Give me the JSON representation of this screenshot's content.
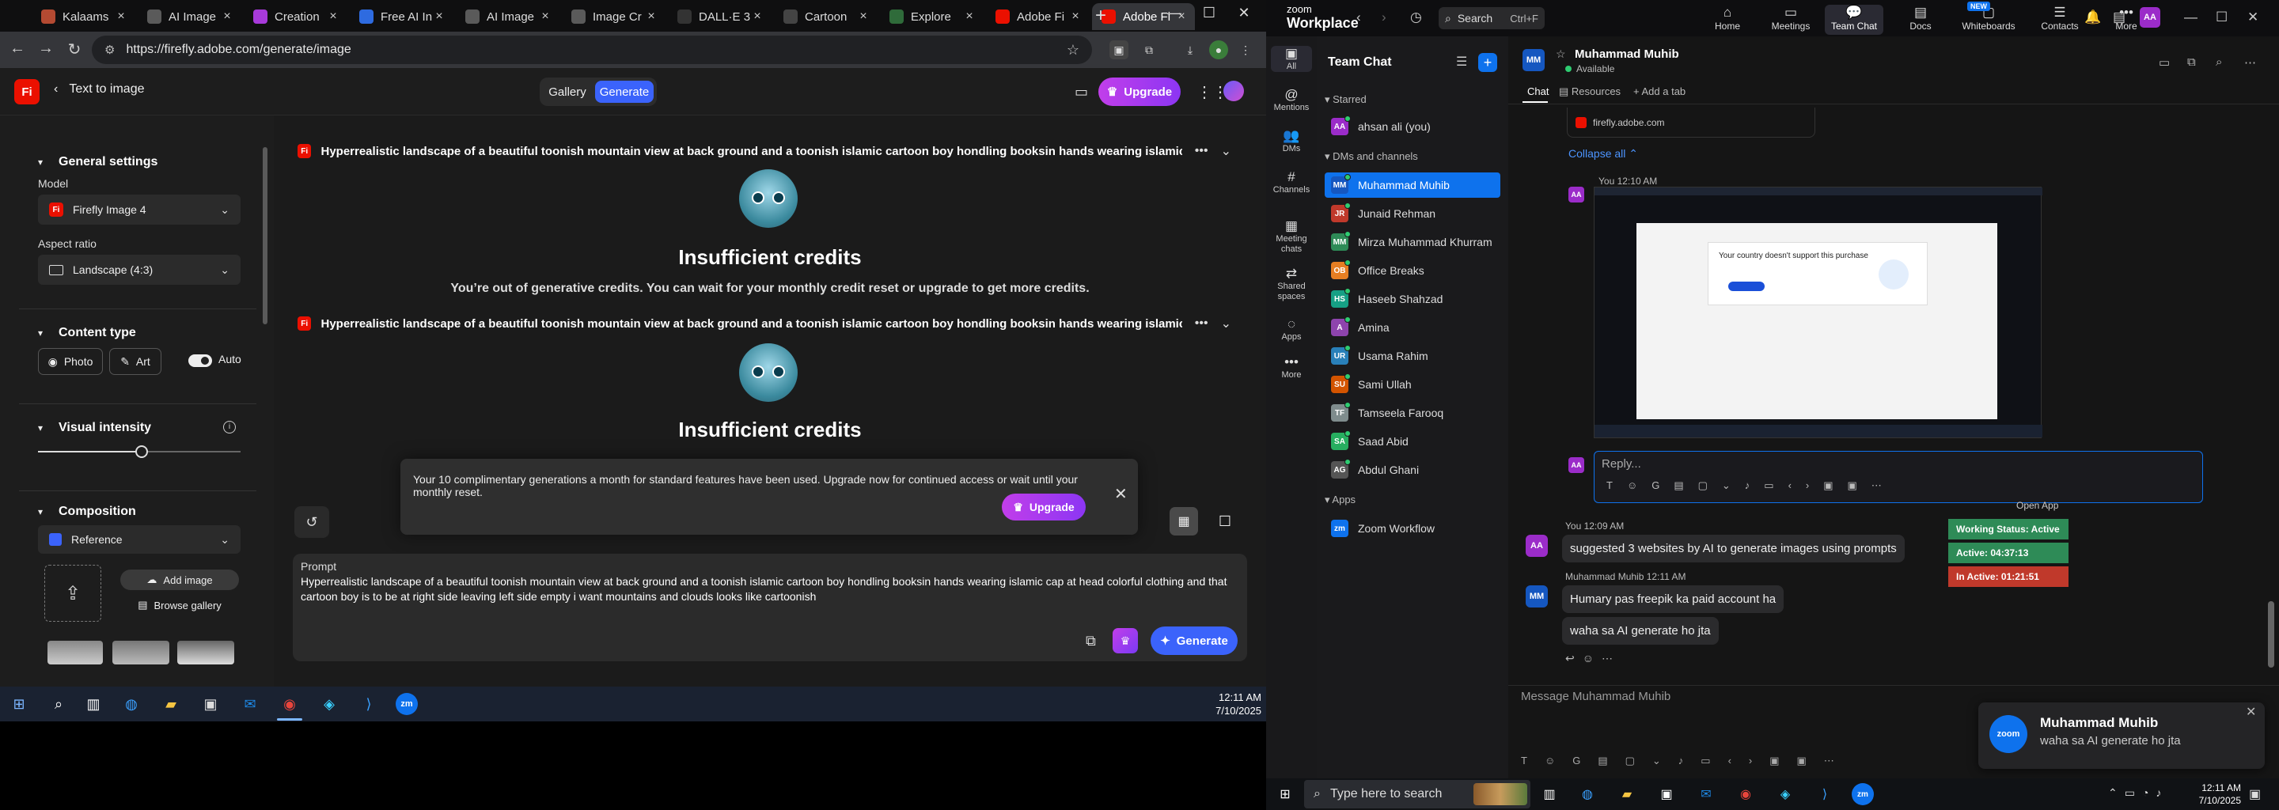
{
  "browser": {
    "tabs": [
      {
        "title": "Kalaams",
        "color": "#b44a32"
      },
      {
        "title": "AI Image",
        "color": "#5a5a5a"
      },
      {
        "title": "Creation",
        "color": "#a83adb"
      },
      {
        "title": "Free AI In",
        "color": "#2e6be0"
      },
      {
        "title": "AI Image",
        "color": "#5a5a5a"
      },
      {
        "title": "Image Cr",
        "color": "#5a5a5a"
      },
      {
        "title": "DALL·E 3",
        "color": "#333"
      },
      {
        "title": "Cartoon",
        "color": "#444"
      },
      {
        "title": "Explore",
        "color": "#2f6b3a"
      },
      {
        "title": "Adobe Fi",
        "color": "#eb1000"
      },
      {
        "title": "Adobe Fi",
        "color": "#eb1000"
      }
    ],
    "url": "https://firefly.adobe.com/generate/image",
    "window_controls": {
      "minimize": "—",
      "maximize": "☐",
      "close": "✕"
    }
  },
  "firefly": {
    "logo": "Fi",
    "back_label": "Text to image",
    "segment": {
      "gallery": "Gallery",
      "generate": "Generate"
    },
    "upgrade": "Upgrade",
    "settings": {
      "general_title": "General settings",
      "model_label": "Model",
      "model_value": "Firefly Image 4",
      "aspect_label": "Aspect ratio",
      "aspect_value": "Landscape (4:3)",
      "content_type_title": "Content type",
      "photo": "Photo",
      "art": "Art",
      "auto": "Auto",
      "visual_intensity_title": "Visual intensity",
      "visual_intensity_value": 0.51,
      "composition_title": "Composition",
      "reference_label": "Reference",
      "add_image": "Add image",
      "browse_gallery": "Browse gallery"
    },
    "generations": [
      {
        "prompt": "Hyperrealistic landscape of a beautiful toonish mountain view at back ground and a toonish islamic cartoon boy hondling booksin hands wearing islamic cap at head cok",
        "title": "Insufficient credits",
        "message": "You’re out of generative credits. You can wait for your monthly credit reset or upgrade to get more credits."
      },
      {
        "prompt": "Hyperrealistic landscape of a beautiful toonish mountain view at back ground and a toonish islamic cartoon boy hondling booksin hands wearing islamic cap at head cok",
        "title": "Insufficient credits",
        "message": ""
      }
    ],
    "toast": {
      "message": "Your 10 complimentary generations a month for standard features have been used. Upgrade now for continued access or wait until your monthly reset.",
      "upgrade": "Upgrade",
      "close": "✕"
    },
    "prompt_box": {
      "label": "Prompt",
      "text": "Hyperrealistic landscape of a beautiful toonish mountain view at back ground and a toonish islamic cartoon boy hondling booksin hands wearing islamic cap at head  colorful clothing and that cartoon boy is to be at right side leaving left side empty i want mountains and clouds looks like cartoonish",
      "generate": "Generate"
    }
  },
  "taskbar_left": {
    "time": "12:11 AM",
    "date": "7/10/2025"
  },
  "zoom": {
    "logo_line1": "zoom",
    "logo_line2": "Workplace",
    "search": "Search",
    "search_shortcut": "Ctrl+F",
    "nav": [
      {
        "label": "Home",
        "glyph": "⌂"
      },
      {
        "label": "Meetings",
        "glyph": "▭"
      },
      {
        "label": "Team Chat",
        "glyph": "💬"
      },
      {
        "label": "Docs",
        "glyph": "▤"
      },
      {
        "label": "Whiteboards",
        "glyph": "▢"
      },
      {
        "label": "Contacts",
        "glyph": "☰"
      },
      {
        "label": "More",
        "glyph": "•••"
      }
    ],
    "new_badge": "NEW",
    "avatar": "AA",
    "rail": [
      {
        "label": "All",
        "glyph": "▣"
      },
      {
        "label": "Mentions",
        "glyph": "@"
      },
      {
        "label": "DMs",
        "glyph": "👥"
      },
      {
        "label": "Channels",
        "glyph": "#"
      },
      {
        "label": "Meeting chats",
        "glyph": "▦"
      },
      {
        "label": "Shared spaces",
        "glyph": "⇄"
      },
      {
        "label": "Apps",
        "glyph": "◌"
      },
      {
        "label": "More",
        "glyph": "•••"
      }
    ],
    "list_title": "Team Chat",
    "starred_header": "Starred",
    "starred": [
      {
        "name": "ahsan ali (you)",
        "initials": "AA",
        "color": "#9b2cc9"
      }
    ],
    "dms_header": "DMs and channels",
    "dms": [
      {
        "name": "Muhammad Muhib",
        "initials": "MM",
        "color": "#1557c0"
      },
      {
        "name": "Junaid Rehman",
        "initials": "JR",
        "color": "#c0392b"
      },
      {
        "name": "Mirza Muhammad Khurram",
        "initials": "MM",
        "color": "#2e8b57"
      },
      {
        "name": "Office Breaks",
        "initials": "OB",
        "color": "#e67e22"
      },
      {
        "name": "Haseeb Shahzad",
        "initials": "HS",
        "color": "#16a085"
      },
      {
        "name": "Amina",
        "initials": "A",
        "color": "#8e44ad"
      },
      {
        "name": "Usama Rahim",
        "initials": "UR",
        "color": "#2980b9"
      },
      {
        "name": "Sami Ullah",
        "initials": "SU",
        "color": "#d35400"
      },
      {
        "name": "Tamseela Farooq",
        "initials": "TF",
        "color": "#7f8c8d"
      },
      {
        "name": "Saad Abid",
        "initials": "SA",
        "color": "#27ae60"
      },
      {
        "name": "Abdul Ghani",
        "initials": "AG",
        "color": "#555"
      }
    ],
    "apps_header": "Apps",
    "apps": [
      {
        "name": "Zoom Workflow",
        "initials": "zm",
        "color": "#0e72ed"
      }
    ],
    "chat": {
      "name": "Muhammad Muhib",
      "initials": "MM",
      "status": "Available",
      "tab_chat": "Chat",
      "tab_resources": "Resources",
      "tab_add": "Add a tab",
      "link_card": "firefly.adobe.com",
      "collapse": "Collapse all",
      "msg1_meta": "You 12:10 AM",
      "shot_text": "Your country doesn't support this purchase",
      "reply_placeholder": "Reply...",
      "open_app": "Open App",
      "msg2_meta": "You 12:09 AM",
      "msg2_text": "suggested 3 websites by AI to generate images using prompts",
      "msg3_meta": "Muhammad Muhib 12:11 AM",
      "msg3_text1": "Humary pas freepik ka paid account ha",
      "msg3_text2": "waha sa AI generate ho jta",
      "tags": [
        {
          "text": "Working Status: Active",
          "color": "#2e8b57"
        },
        {
          "text": "Active: 04:37:13",
          "color": "#2e8b57"
        },
        {
          "text": "In Active: 01:21:51",
          "color": "#c0392b"
        }
      ],
      "compose_placeholder": "Message Muhammad Muhib"
    },
    "notification": {
      "name": "Muhammad Muhib",
      "message": "waha sa AI generate ho jta",
      "logo": "zoom"
    }
  },
  "taskbar_right": {
    "search": "Type here to search",
    "time": "12:11 AM",
    "date": "7/10/2025"
  }
}
